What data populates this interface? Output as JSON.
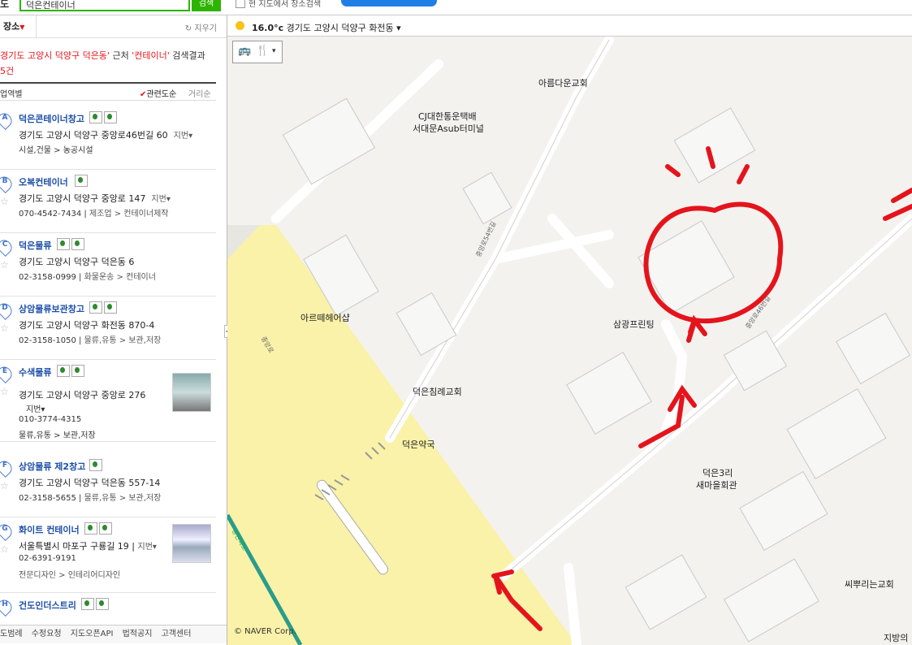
{
  "topbar": {
    "search_value": "덕은컨테이너",
    "search_button": "검색",
    "checkbox_label": "현 지도에서 장소검색",
    "edge_glyph": "도"
  },
  "left": {
    "tab_label": "장소",
    "clear_label": "지우기",
    "summary_loc": "경기도 고양시 덕양구 덕은동'",
    "summary_near": " 근처 ",
    "summary_kw": "'컨테이너'",
    "summary_tail": " 검색결과",
    "summary_count": "5건",
    "sort_left": "업역별",
    "sort_relevance": "관련도순",
    "sort_distance": "거리순",
    "items": [
      {
        "letter": "A",
        "name": "덕은콘테이너창고",
        "addr": "경기도 고양시 덕양구 중앙로46번길 60",
        "jibun": "지번",
        "phone": "",
        "cat": "시설,건물 > 농공시설"
      },
      {
        "letter": "B",
        "name": "오복컨테이너",
        "addr": "경기도 고양시 덕양구 중앙로 147",
        "jibun": "지번",
        "phone": "070-4542-7434",
        "cat": "제조업 > 컨테이너제작"
      },
      {
        "letter": "C",
        "name": "덕은물류",
        "addr": "경기도 고양시 덕양구 덕은동 6",
        "jibun": "",
        "phone": "02-3158-0999",
        "cat": "화물운송 > 컨테이너"
      },
      {
        "letter": "D",
        "name": "상암물류보관창고",
        "addr": "경기도 고양시 덕양구 화전동 870-4",
        "jibun": "",
        "phone": "02-3158-1050",
        "cat": "물류,유통 > 보관,저장"
      },
      {
        "letter": "E",
        "name": "수색물류",
        "addr": "경기도 고양시 덕양구 중앙로 276",
        "jibun": "지번",
        "phone": "010-3774-4315",
        "cat": "물류,유통 > 보관,저장"
      },
      {
        "letter": "F",
        "name": "상암물류 제2창고",
        "addr": "경기도 고양시 덕양구 덕은동 557-14",
        "jibun": "",
        "phone": "02-3158-5655",
        "cat": "물류,유통 > 보관,저장"
      },
      {
        "letter": "G",
        "name": "화이트 컨테이너",
        "addr": "서울특별시 마포구 구룡길 19",
        "jibun": "지번",
        "phone": "02-6391-9191",
        "cat": "전문디자인 > 인테리어디자인"
      },
      {
        "letter": "H",
        "name": "건도인더스트리",
        "addr": "",
        "jibun": "",
        "phone": "",
        "cat": ""
      }
    ],
    "footer": [
      "도범례",
      "수정요청",
      "지도오픈API",
      "법적공지",
      "고객센터"
    ]
  },
  "weather": {
    "temp": "16.0°c",
    "location": "경기도 고양시 덕양구 화전동"
  },
  "map": {
    "copyright": "© NAVER Corp.",
    "labels": [
      {
        "id": "church1",
        "text": "아름다운교회"
      },
      {
        "id": "terminal1",
        "text": "CJ대한통운택배"
      },
      {
        "id": "terminal2",
        "text": "서대문Asub터미널"
      },
      {
        "id": "hairshop",
        "text": "아르떼헤어샵"
      },
      {
        "id": "printing",
        "text": "삼광프린팅"
      },
      {
        "id": "church2",
        "text": "덕은침례교회"
      },
      {
        "id": "pharmacy",
        "text": "덕은약국"
      },
      {
        "id": "hall1",
        "text": "덕은3리"
      },
      {
        "id": "hall2",
        "text": "새마을회관"
      },
      {
        "id": "church3",
        "text": "씨뿌리는교회"
      },
      {
        "id": "firestation",
        "text": "지방의"
      }
    ],
    "road_labels": [
      "중앙로",
      "중앙로54번길",
      "중앙로46번길",
      "강변북로"
    ]
  }
}
